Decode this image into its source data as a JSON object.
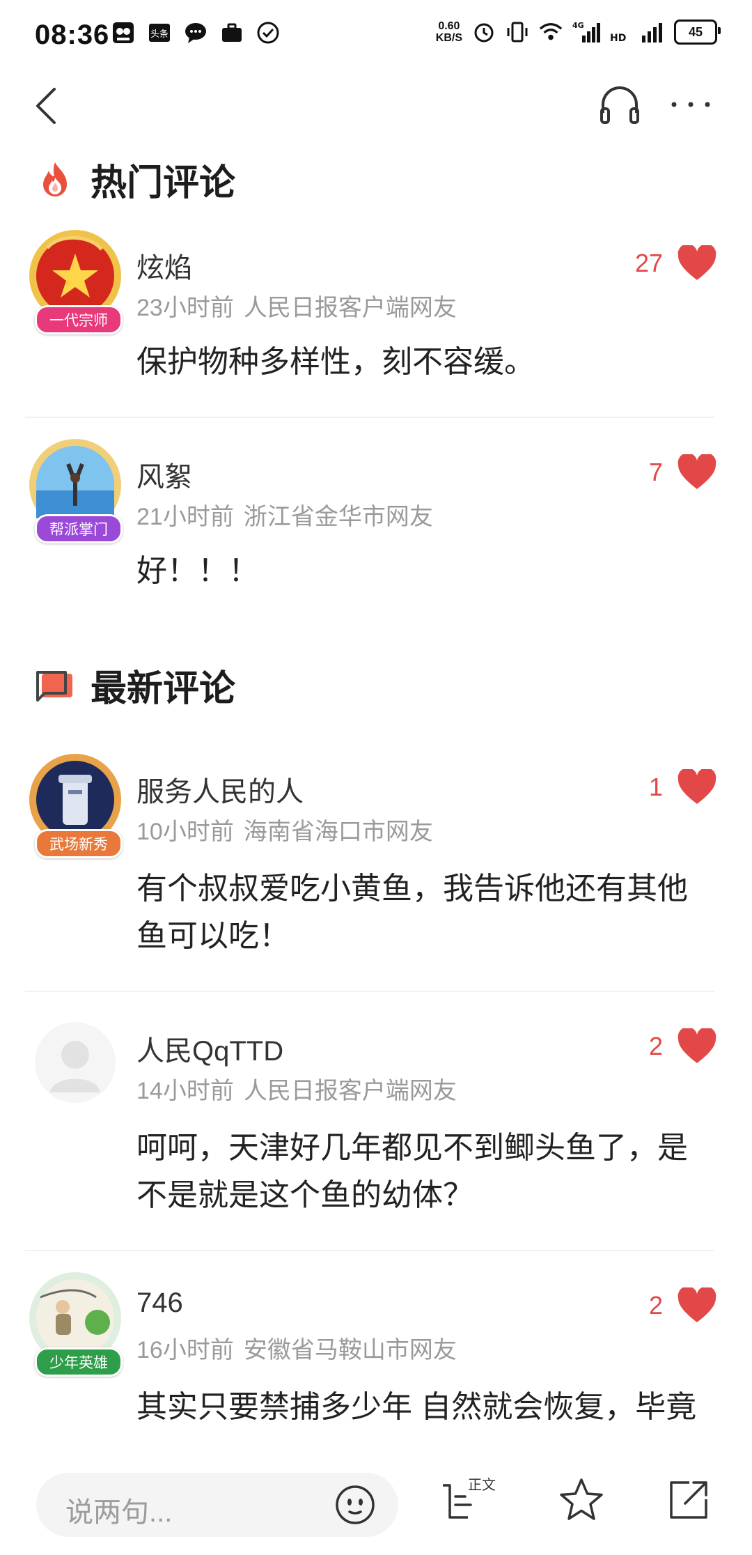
{
  "status_bar": {
    "time": "08:36",
    "net_speed_value": "0.60",
    "net_speed_unit": "KB/S",
    "battery": "45",
    "network_label": "4G",
    "hd_label": "HD",
    "app_icon_label": "头条"
  },
  "sections": {
    "hot": {
      "title": "热门评论"
    },
    "latest": {
      "title": "最新评论"
    }
  },
  "hot_comments": [
    {
      "name": "炫焰",
      "time": "23小时前",
      "location": "人民日报客户端网友",
      "badge": "一代宗师",
      "likes": "27",
      "text": "保护物种多样性，刻不容缓。"
    },
    {
      "name": "风絮",
      "time": "21小时前",
      "location": "浙江省金华市网友",
      "badge": "帮派掌门",
      "likes": "7",
      "text": "好！！！"
    }
  ],
  "latest_comments": [
    {
      "name": "服务人民的人",
      "time": "10小时前",
      "location": "海南省海口市网友",
      "badge": "武场新秀",
      "likes": "1",
      "text": "有个叔叔爱吃小黄鱼，我告诉他还有其他鱼可以吃！"
    },
    {
      "name": "人民QqTTD",
      "time": "14小时前",
      "location": "人民日报客户端网友",
      "likes": "2",
      "text": "呵呵，天津好几年都见不到鲫头鱼了，是不是就是这个鱼的幼体？"
    },
    {
      "name": "746",
      "time": "16小时前",
      "location": "安徽省马鞍山市网友",
      "badge": "少年英雄",
      "likes": "2",
      "text": "其实只要禁捕多少年 自然就会恢复，毕竟还是有野生种群的"
    }
  ],
  "bottom_bar": {
    "input_placeholder": "说两句...",
    "article_label": "正文"
  },
  "colors": {
    "like_red": "#e34848",
    "badge_red": "#e8397a",
    "badge_purple": "#9b4ad8",
    "badge_orange": "#e8793a",
    "badge_green": "#2f9e4a"
  }
}
